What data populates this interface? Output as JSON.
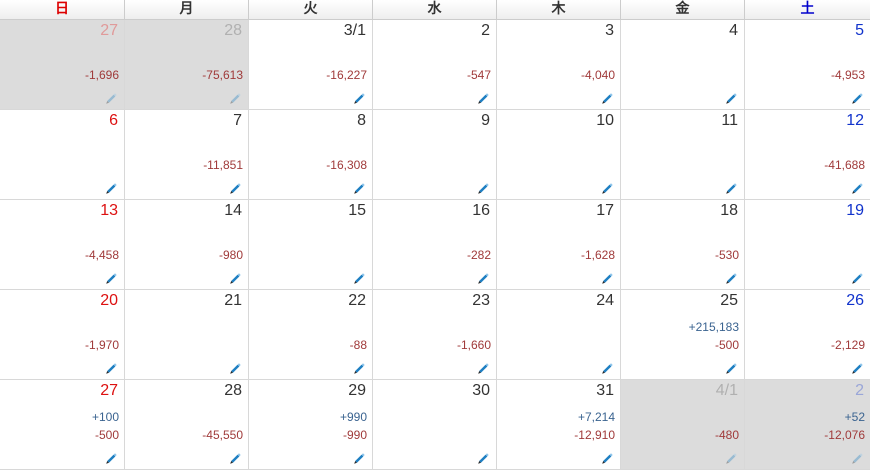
{
  "colors": {
    "sunday": "#dd1111",
    "saturday": "#1133cc",
    "income": "#3a6390",
    "expense": "#a03a3a",
    "pencil": "#1e7fc2"
  },
  "weekdays": [
    "日",
    "月",
    "火",
    "水",
    "木",
    "金",
    "土"
  ],
  "weeks": [
    [
      {
        "label": "27",
        "other_month": true,
        "amounts": [
          {
            "text": "-1,696",
            "kind": "minus"
          }
        ]
      },
      {
        "label": "28",
        "other_month": true,
        "amounts": [
          {
            "text": "-75,613",
            "kind": "minus"
          }
        ]
      },
      {
        "label": "3/1",
        "other_month": false,
        "amounts": [
          {
            "text": "-16,227",
            "kind": "minus"
          }
        ]
      },
      {
        "label": "2",
        "other_month": false,
        "amounts": [
          {
            "text": "-547",
            "kind": "minus"
          }
        ]
      },
      {
        "label": "3",
        "other_month": false,
        "amounts": [
          {
            "text": "-4,040",
            "kind": "minus"
          }
        ]
      },
      {
        "label": "4",
        "other_month": false,
        "amounts": []
      },
      {
        "label": "5",
        "other_month": false,
        "amounts": [
          {
            "text": "-4,953",
            "kind": "minus"
          }
        ]
      }
    ],
    [
      {
        "label": "6",
        "other_month": false,
        "amounts": []
      },
      {
        "label": "7",
        "other_month": false,
        "amounts": [
          {
            "text": "-11,851",
            "kind": "minus"
          }
        ]
      },
      {
        "label": "8",
        "other_month": false,
        "amounts": [
          {
            "text": "-16,308",
            "kind": "minus"
          }
        ]
      },
      {
        "label": "9",
        "other_month": false,
        "amounts": []
      },
      {
        "label": "10",
        "other_month": false,
        "amounts": []
      },
      {
        "label": "11",
        "other_month": false,
        "amounts": []
      },
      {
        "label": "12",
        "other_month": false,
        "amounts": [
          {
            "text": "-41,688",
            "kind": "minus"
          }
        ]
      }
    ],
    [
      {
        "label": "13",
        "other_month": false,
        "amounts": [
          {
            "text": "-4,458",
            "kind": "minus"
          }
        ]
      },
      {
        "label": "14",
        "other_month": false,
        "amounts": [
          {
            "text": "-980",
            "kind": "minus"
          }
        ]
      },
      {
        "label": "15",
        "other_month": false,
        "amounts": []
      },
      {
        "label": "16",
        "other_month": false,
        "amounts": [
          {
            "text": "-282",
            "kind": "minus"
          }
        ]
      },
      {
        "label": "17",
        "other_month": false,
        "amounts": [
          {
            "text": "-1,628",
            "kind": "minus"
          }
        ]
      },
      {
        "label": "18",
        "other_month": false,
        "amounts": [
          {
            "text": "-530",
            "kind": "minus"
          }
        ]
      },
      {
        "label": "19",
        "other_month": false,
        "amounts": []
      }
    ],
    [
      {
        "label": "20",
        "other_month": false,
        "amounts": [
          {
            "text": "-1,970",
            "kind": "minus"
          }
        ]
      },
      {
        "label": "21",
        "other_month": false,
        "amounts": []
      },
      {
        "label": "22",
        "other_month": false,
        "amounts": [
          {
            "text": "-88",
            "kind": "minus"
          }
        ]
      },
      {
        "label": "23",
        "other_month": false,
        "amounts": [
          {
            "text": "-1,660",
            "kind": "minus"
          }
        ]
      },
      {
        "label": "24",
        "other_month": false,
        "amounts": []
      },
      {
        "label": "25",
        "other_month": false,
        "amounts": [
          {
            "text": "+215,183",
            "kind": "plus"
          },
          {
            "text": "-500",
            "kind": "minus"
          }
        ]
      },
      {
        "label": "26",
        "other_month": false,
        "amounts": [
          {
            "text": "-2,129",
            "kind": "minus"
          }
        ]
      }
    ],
    [
      {
        "label": "27",
        "other_month": false,
        "amounts": [
          {
            "text": "+100",
            "kind": "plus"
          },
          {
            "text": "-500",
            "kind": "minus"
          }
        ]
      },
      {
        "label": "28",
        "other_month": false,
        "amounts": [
          {
            "text": "-45,550",
            "kind": "minus"
          }
        ]
      },
      {
        "label": "29",
        "other_month": false,
        "amounts": [
          {
            "text": "+990",
            "kind": "plus"
          },
          {
            "text": "-990",
            "kind": "minus"
          }
        ]
      },
      {
        "label": "30",
        "other_month": false,
        "amounts": []
      },
      {
        "label": "31",
        "other_month": false,
        "amounts": [
          {
            "text": "+7,214",
            "kind": "plus"
          },
          {
            "text": "-12,910",
            "kind": "minus"
          }
        ]
      },
      {
        "label": "4/1",
        "other_month": true,
        "amounts": [
          {
            "text": "-480",
            "kind": "minus"
          }
        ]
      },
      {
        "label": "2",
        "other_month": true,
        "amounts": [
          {
            "text": "+52",
            "kind": "plus"
          },
          {
            "text": "-12,076",
            "kind": "minus"
          }
        ]
      }
    ]
  ],
  "edit_icon": "pencil-icon"
}
